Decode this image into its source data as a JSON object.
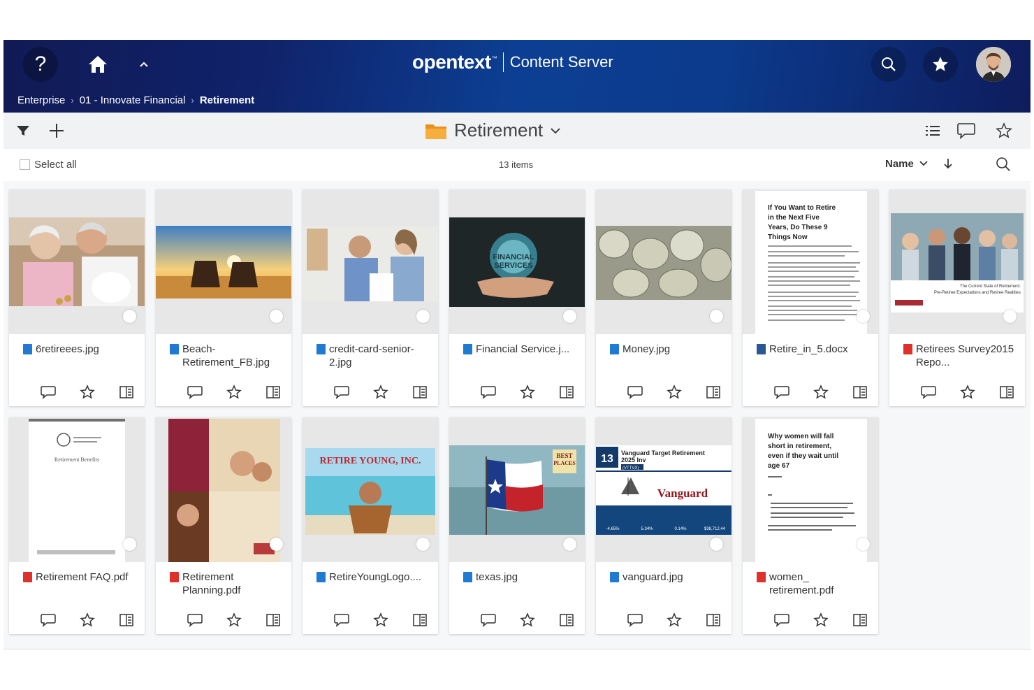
{
  "header": {
    "brand": "opentext",
    "brand_tm": "™",
    "product": "Content Server",
    "help_label": "?",
    "icons": {
      "help": "help-icon",
      "home": "home-icon",
      "collapse": "chevron-up-icon",
      "search": "search-icon",
      "favorites": "star-icon",
      "profile": "avatar"
    }
  },
  "breadcrumb": [
    {
      "label": "Enterprise"
    },
    {
      "label": "01 - Innovate Financial"
    },
    {
      "label": "Retirement"
    }
  ],
  "toolbar": {
    "title": "Retirement",
    "icons": [
      "filter-icon",
      "add-icon",
      "folder-icon",
      "chevron-down-icon",
      "list-view-icon",
      "comment-icon",
      "star-icon"
    ]
  },
  "subbar": {
    "select_all": "Select all",
    "item_count": "13 items",
    "sort_by": "Name"
  },
  "items": [
    {
      "name": "6retireees.jpg",
      "type": "image",
      "thumb": "couple-piggybank"
    },
    {
      "name": "Beach-Retirement_FB.jpg",
      "type": "image",
      "thumb": "beach-sunset"
    },
    {
      "name": "credit-card-senior-2.jpg",
      "type": "image",
      "thumb": "seniors-desk"
    },
    {
      "name": "Financial Service.j...",
      "type": "image",
      "thumb": "financial-services"
    },
    {
      "name": "Money.jpg",
      "type": "image",
      "thumb": "money"
    },
    {
      "name": "Retire_in_5.docx",
      "type": "docx",
      "thumb": "doc-page",
      "thumb_title": "If You Want to Retire in the Next Five Years, Do These 9 Things Now"
    },
    {
      "name": "Retirees Survey2015 Repo...",
      "type": "pdf",
      "thumb": "retirees-survey",
      "thumb_caption_1": "The Current State of Retirement:",
      "thumb_caption_2": "Pre-Retiree Expectations and Retiree Realities"
    },
    {
      "name": "Retirement FAQ.pdf",
      "type": "pdf",
      "thumb": "faq-page",
      "thumb_title": "Retirement Benefits"
    },
    {
      "name": "Retirement Planning.pdf",
      "type": "pdf",
      "thumb": "planning-brochure"
    },
    {
      "name": "RetireYoungLogo....",
      "type": "image",
      "thumb": "retire-young",
      "thumb_title": "RETIRE YOUNG, INC."
    },
    {
      "name": "texas.jpg",
      "type": "image",
      "thumb": "texas-flag",
      "thumb_badge": "BEST PLACES"
    },
    {
      "name": "vanguard.jpg",
      "type": "image",
      "thumb": "vanguard",
      "thumb_number": "13",
      "thumb_title": "Vanguard Target Retirement 2025 Inv",
      "thumb_ticker": "(VTTVX)",
      "thumb_brand": "Vanguard",
      "thumb_stats": [
        "-4.65%",
        "5.34%",
        "0.14%",
        "$38,712.44"
      ]
    },
    {
      "name": "women_ retirement.pdf",
      "type": "pdf",
      "thumb": "women-page",
      "thumb_title": "Why women will fall short in retirement, even if they wait until age 67"
    }
  ],
  "card_actions": [
    "comment-icon",
    "star-icon",
    "properties-icon"
  ],
  "colors": {
    "header_dark": "#111a55",
    "header_mid": "#0c3f93",
    "pdf": "#e0302b",
    "image": "#1f7ad1",
    "docx": "#2b5797",
    "folder": "#f2a12a"
  }
}
